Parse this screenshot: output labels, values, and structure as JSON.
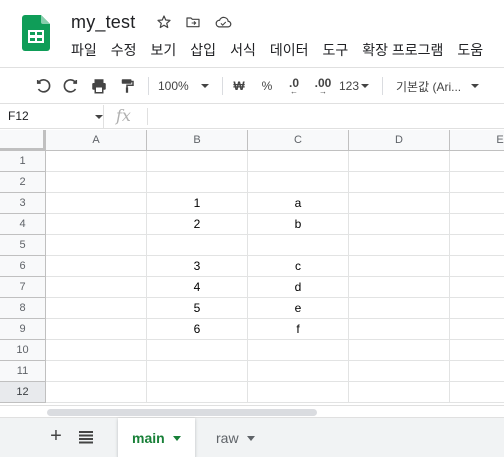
{
  "app": {
    "doc_title": "my_test",
    "brand_color": "#0f9d58",
    "icons": [
      "star-icon",
      "move-to-folder-icon",
      "cloud-status-icon"
    ]
  },
  "menu": [
    "파일",
    "수정",
    "보기",
    "삽입",
    "서식",
    "데이터",
    "도구",
    "확장 프로그램",
    "도움"
  ],
  "toolbar": {
    "zoom": "100%",
    "currency": "₩",
    "percent": "%",
    "decrease_decimal": ".0",
    "increase_decimal": ".00",
    "number_format": "123",
    "font": "기본값 (Ari..."
  },
  "formula_bar": {
    "name_box": "F12",
    "fx": "fx",
    "value": ""
  },
  "grid": {
    "columns": [
      "A",
      "B",
      "C",
      "D",
      "E"
    ],
    "rows": [
      "1",
      "2",
      "3",
      "4",
      "5",
      "6",
      "7",
      "8",
      "9",
      "10",
      "11",
      "12"
    ],
    "selected_row": "12",
    "cells": [
      [
        "",
        "",
        "",
        "",
        ""
      ],
      [
        "",
        "",
        "",
        "",
        ""
      ],
      [
        "",
        "1",
        "a",
        "",
        ""
      ],
      [
        "",
        "2",
        "b",
        "",
        ""
      ],
      [
        "",
        "",
        "",
        "",
        ""
      ],
      [
        "",
        "3",
        "c",
        "",
        ""
      ],
      [
        "",
        "4",
        "d",
        "",
        ""
      ],
      [
        "",
        "5",
        "e",
        "",
        ""
      ],
      [
        "",
        "6",
        "f",
        "",
        ""
      ],
      [
        "",
        "",
        "",
        "",
        ""
      ],
      [
        "",
        "",
        "",
        "",
        ""
      ],
      [
        "",
        "",
        "",
        "",
        ""
      ]
    ]
  },
  "sheets": {
    "add_label": "+",
    "tabs": [
      {
        "label": "main",
        "active": true
      },
      {
        "label": "raw",
        "active": false
      }
    ],
    "active_color": "#188038"
  }
}
